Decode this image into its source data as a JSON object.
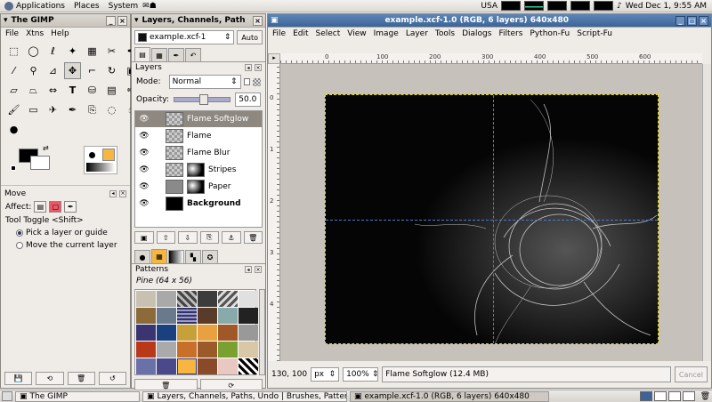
{
  "topbar": {
    "menus": [
      "Applications",
      "Places",
      "System"
    ],
    "keyboard": "USA",
    "clock": "Wed Dec  1,  9:55 AM"
  },
  "toolbox": {
    "title": "The GIMP",
    "menu": [
      "File",
      "Xtns",
      "Help"
    ],
    "dock_title": "Move",
    "affect_label": "Affect:",
    "tool_toggle": "Tool Toggle  <Shift>",
    "option1": "Pick a layer or guide",
    "option2": "Move the current layer"
  },
  "layers_window": {
    "title": "Layers, Channels, Path",
    "image_name": "example.xcf-1",
    "auto_label": "Auto",
    "panel_title": "Layers",
    "mode_label": "Mode:",
    "mode_value": "Normal",
    "opacity_label": "Opacity:",
    "opacity_value": "50.0",
    "layers": [
      {
        "name": "Flame Softglow",
        "selected": true
      },
      {
        "name": "Flame",
        "selected": false
      },
      {
        "name": "Flame Blur",
        "selected": false
      },
      {
        "name": "Stripes",
        "selected": false
      },
      {
        "name": "Paper",
        "selected": false
      },
      {
        "name": "Background",
        "selected": false
      }
    ],
    "patterns_title": "Patterns",
    "pattern_name": "Pine (64 x 56)"
  },
  "image_window": {
    "title": "example.xcf-1.0 (RGB, 6 layers) 640x480",
    "menu": [
      "File",
      "Edit",
      "Select",
      "View",
      "Image",
      "Layer",
      "Tools",
      "Dialogs",
      "Filters",
      "Python-Fu",
      "Script-Fu"
    ],
    "ruler_h": [
      "0",
      "100",
      "200",
      "300",
      "400",
      "500",
      "600"
    ],
    "ruler_v": [
      "0",
      "1",
      "2",
      "3",
      "4"
    ],
    "coords": "130, 100",
    "unit": "px",
    "zoom": "100%",
    "status": "Flame Softglow (12.4 MB)",
    "cancel_label": "Cancel"
  },
  "taskbar": {
    "tasks": [
      "The GIMP",
      "Layers, Channels, Paths, Undo | Brushes, Patterns, G...",
      "example.xcf-1.0 (RGB, 6 layers) 640x480"
    ]
  }
}
